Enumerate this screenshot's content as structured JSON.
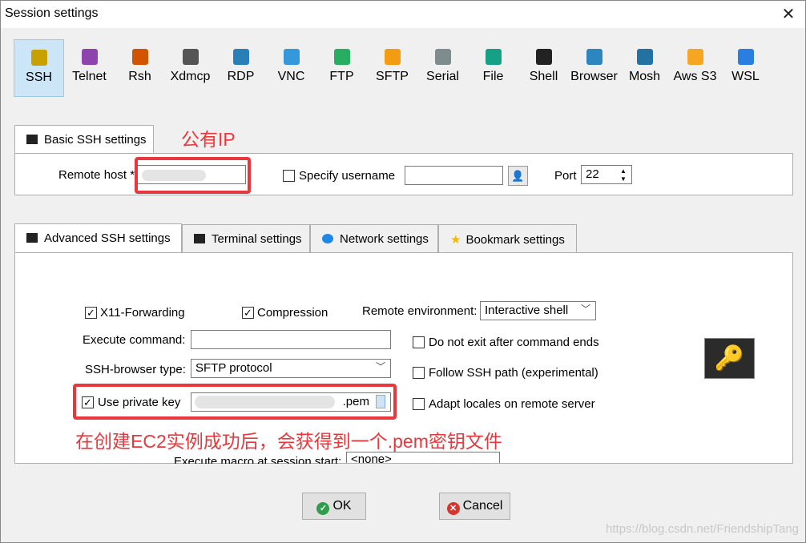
{
  "window": {
    "title": "Session settings",
    "close": "✕"
  },
  "protocols": [
    {
      "label": "SSH",
      "icon": "key-icon",
      "color": "#c8a000",
      "active": true
    },
    {
      "label": "Telnet",
      "icon": "telnet-icon",
      "color": "#8e44ad"
    },
    {
      "label": "Rsh",
      "icon": "rsh-icon",
      "color": "#d35400"
    },
    {
      "label": "Xdmcp",
      "icon": "xdmcp-icon",
      "color": "#555555"
    },
    {
      "label": "RDP",
      "icon": "rdp-icon",
      "color": "#2980b9"
    },
    {
      "label": "VNC",
      "icon": "vnc-icon",
      "color": "#3498db"
    },
    {
      "label": "FTP",
      "icon": "ftp-icon",
      "color": "#27ae60"
    },
    {
      "label": "SFTP",
      "icon": "sftp-icon",
      "color": "#f39c12"
    },
    {
      "label": "Serial",
      "icon": "serial-icon",
      "color": "#7f8c8d"
    },
    {
      "label": "File",
      "icon": "file-icon",
      "color": "#16a085"
    },
    {
      "label": "Shell",
      "icon": "shell-icon",
      "color": "#222222"
    },
    {
      "label": "Browser",
      "icon": "browser-icon",
      "color": "#2e86c1"
    },
    {
      "label": "Mosh",
      "icon": "mosh-icon",
      "color": "#2471a3"
    },
    {
      "label": "Aws S3",
      "icon": "aws-s3-icon",
      "color": "#f5a623"
    },
    {
      "label": "WSL",
      "icon": "wsl-icon",
      "color": "#2a7de1"
    }
  ],
  "basic": {
    "tab": "Basic SSH settings",
    "remote_host_label": "Remote host *",
    "remote_host_value": "",
    "specify_username": "Specify username",
    "username_value": "",
    "port_label": "Port",
    "port_value": "22"
  },
  "annotations": {
    "public_ip": "公有IP",
    "pem_note": "在创建EC2实例成功后，会获得到一个.pem密钥文件"
  },
  "adv_tabs": [
    "Advanced SSH settings",
    "Terminal settings",
    "Network settings",
    "Bookmark settings"
  ],
  "advanced": {
    "x11": "X11-Forwarding",
    "compression": "Compression",
    "remote_env_label": "Remote environment:",
    "remote_env_value": "Interactive shell",
    "exec_cmd_label": "Execute command:",
    "exec_cmd_value": "",
    "no_exit": "Do not exit after command ends",
    "ssh_browser_label": "SSH-browser type:",
    "ssh_browser_value": "SFTP protocol",
    "follow_path": "Follow SSH path (experimental)",
    "use_private_key": "Use private key",
    "private_key_value": ".pem",
    "adapt_locales": "Adapt locales on remote server",
    "exec_macro_label": "Execute macro at session start:",
    "exec_macro_value": "<none>"
  },
  "buttons": {
    "ok": "OK",
    "cancel": "Cancel"
  },
  "watermark": "https://blog.csdn.net/FriendshipTang"
}
